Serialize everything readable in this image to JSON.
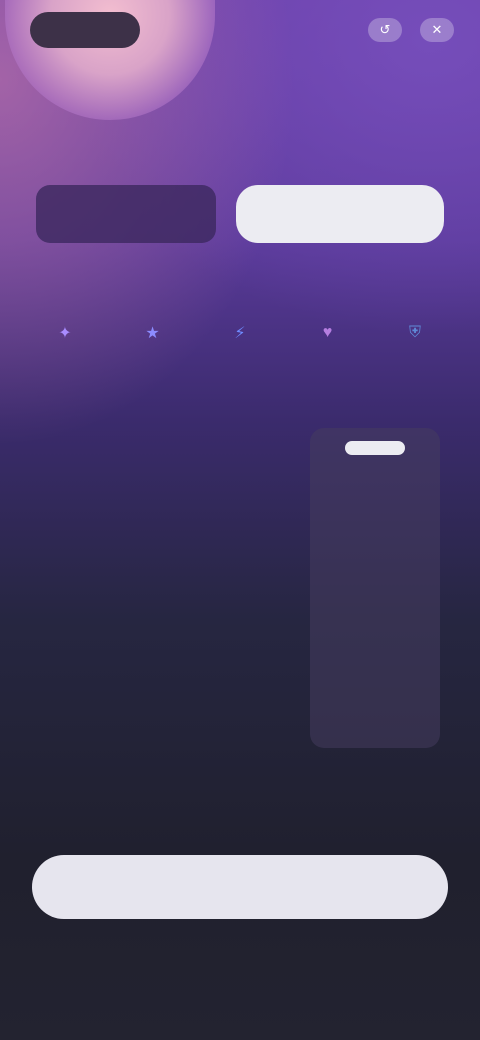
{
  "brand": {
    "logo_text": ""
  },
  "top_actions": {
    "restore_icon": "restore-icon",
    "close_icon": "close-icon"
  },
  "headline": "",
  "plan": {
    "price": "",
    "period": "",
    "trial_label": ""
  },
  "subline": "",
  "features": [
    {
      "icon": "sparkle-icon",
      "label": "",
      "color": "#a98cff"
    },
    {
      "icon": "star-icon",
      "label": "",
      "color": "#8c8cff"
    },
    {
      "icon": "lightning-icon",
      "label": "",
      "color": "#6f8bff"
    },
    {
      "icon": "heart-icon",
      "label": "",
      "color": "#b57ee0"
    },
    {
      "icon": "shield-icon",
      "label": "",
      "color": "#5f8ad8"
    }
  ],
  "comparison": {
    "header": {
      "feature": "",
      "free": "",
      "pro": ""
    },
    "rows": [
      {
        "label": "",
        "free": "",
        "pro": ""
      },
      {
        "label": "",
        "free": "",
        "pro": ""
      },
      {
        "label": "",
        "free": "",
        "pro": ""
      },
      {
        "label": "",
        "free": "",
        "pro": ""
      }
    ]
  },
  "cta_label": "",
  "footer_text": ""
}
